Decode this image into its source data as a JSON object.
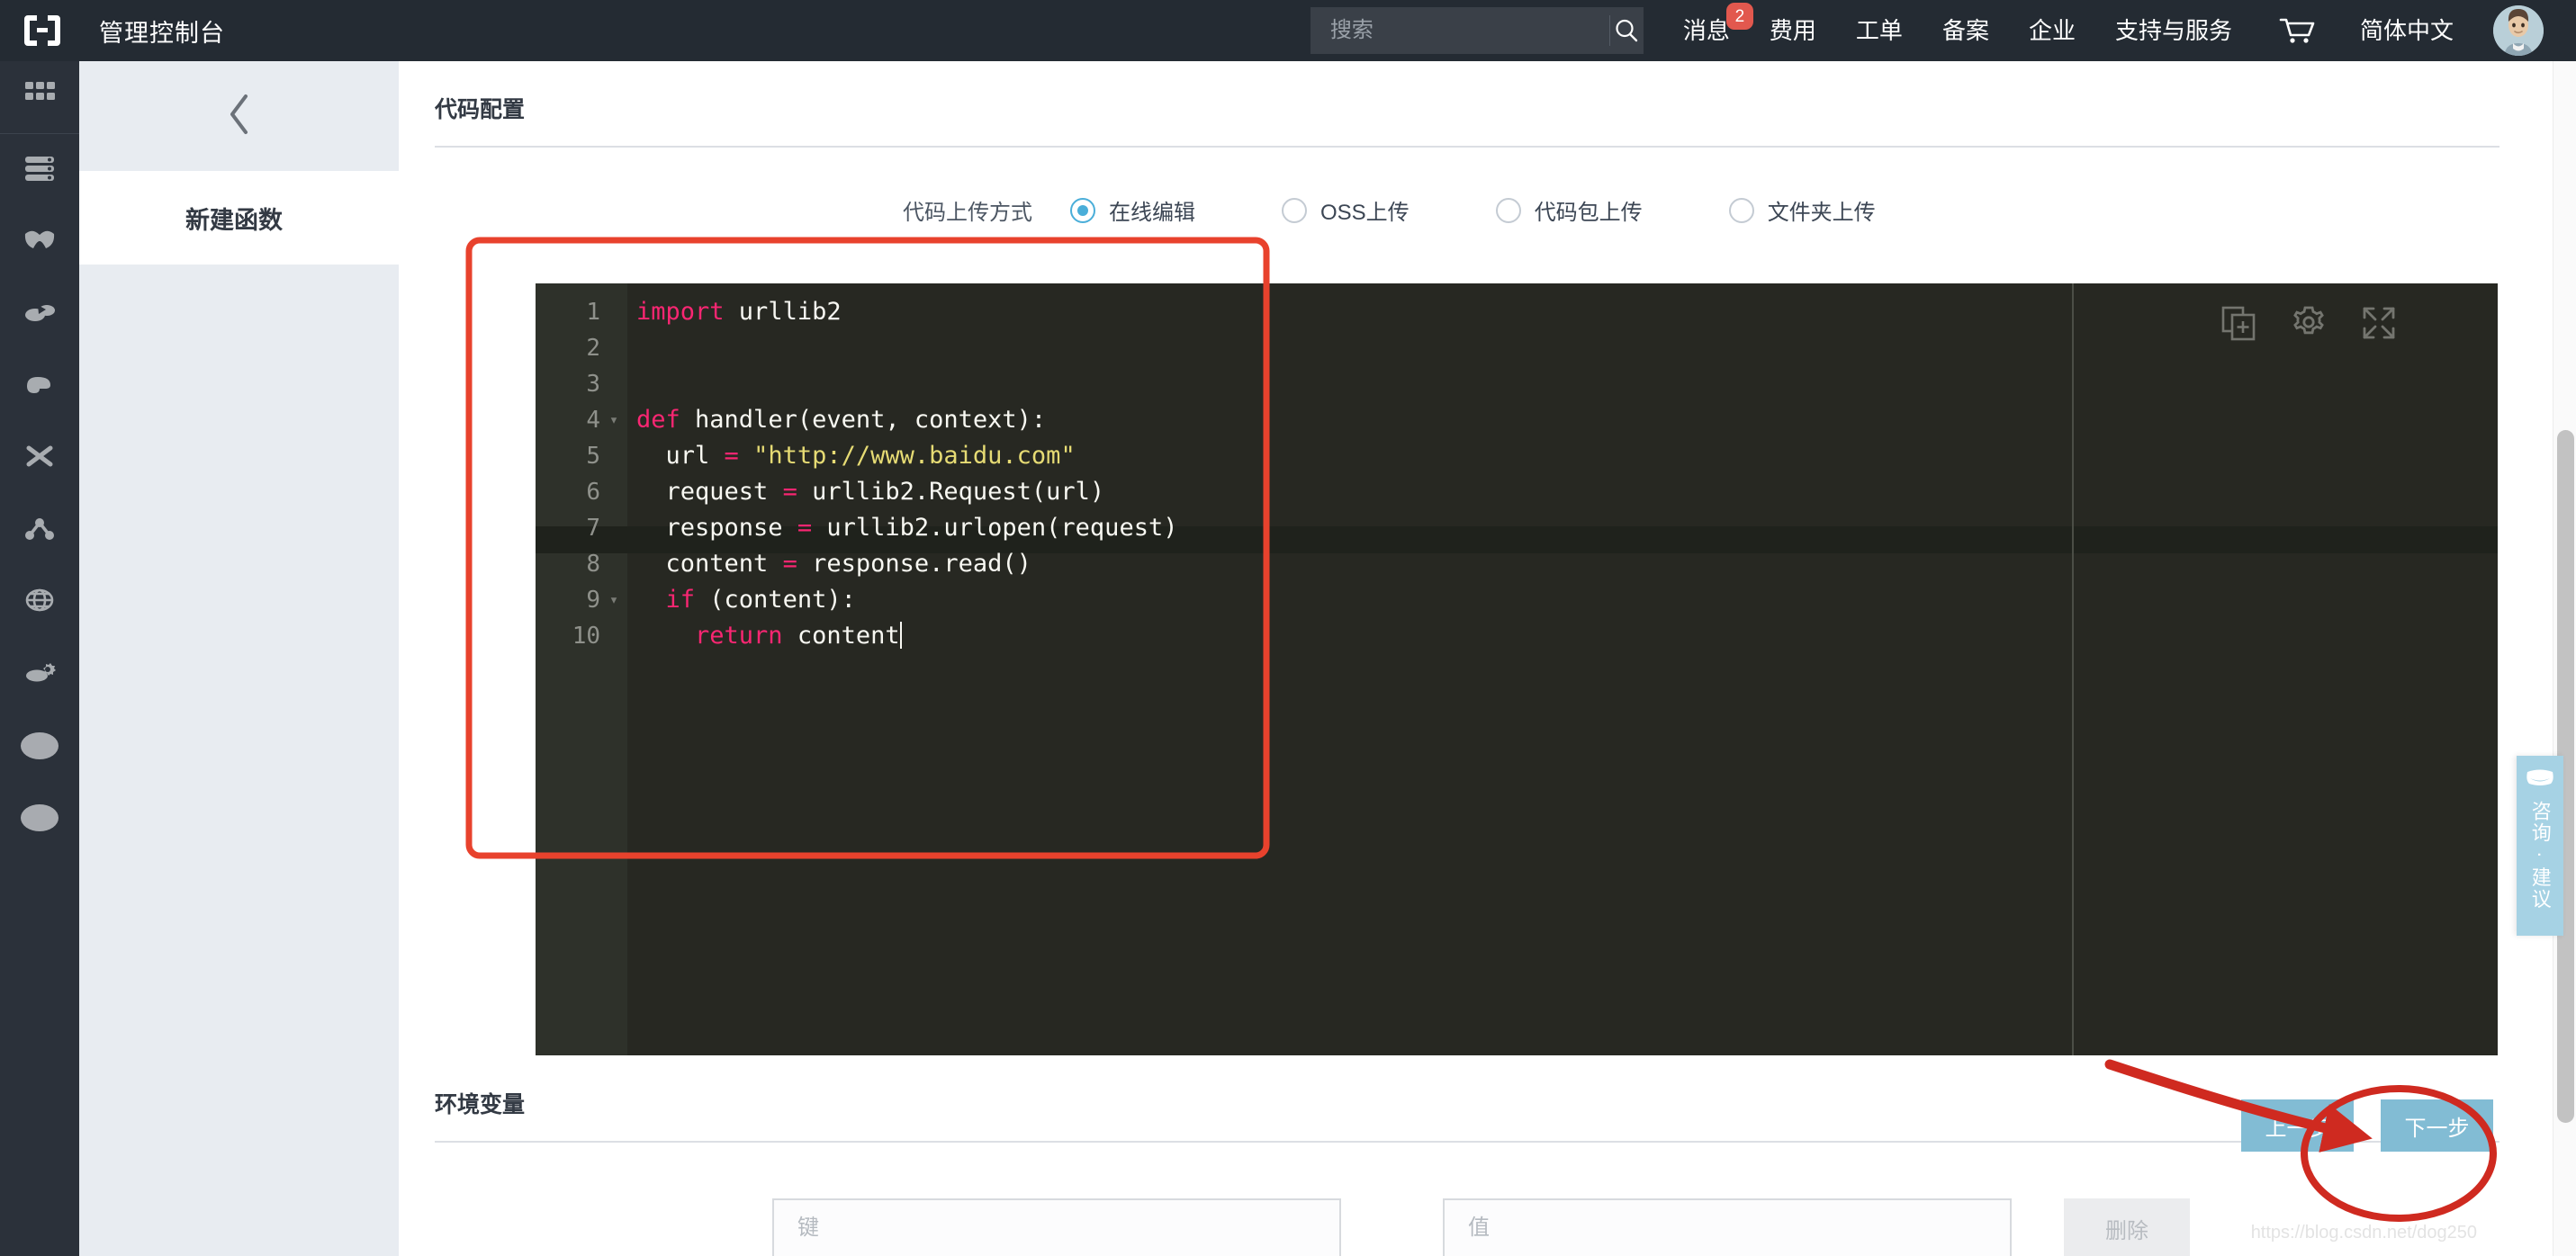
{
  "topbar": {
    "logo_icon": "brackets-logo-icon",
    "title": "管理控制台",
    "search": {
      "placeholder": "搜索",
      "value": "",
      "icon": "search-icon"
    },
    "nav": [
      {
        "label": "消息",
        "badge": "2"
      },
      {
        "label": "费用",
        "badge": ""
      },
      {
        "label": "工单",
        "badge": ""
      },
      {
        "label": "备案",
        "badge": ""
      },
      {
        "label": "企业",
        "badge": ""
      },
      {
        "label": "支持与服务",
        "badge": ""
      }
    ],
    "cart_icon": "shopping-cart-icon",
    "language": "简体中文",
    "avatar_icon": "user-avatar-icon"
  },
  "rail": {
    "items": [
      {
        "icon": "grid-apps-icon"
      },
      {
        "icon": "server-stack-icon"
      },
      {
        "icon": "shield-security-icon"
      },
      {
        "icon": "cloud-storage-icon"
      },
      {
        "icon": "database-icon"
      },
      {
        "icon": "network-cross-icon"
      },
      {
        "icon": "nodes-graph-icon"
      },
      {
        "icon": "globe-network-icon"
      },
      {
        "icon": "cloud-gear-icon"
      },
      {
        "icon": "ellipse-icon"
      },
      {
        "icon": "ellipse-icon"
      }
    ]
  },
  "sidepanel": {
    "collapse_icon": "chevron-left-icon",
    "title": "新建函数"
  },
  "main": {
    "code_config": {
      "heading": "代码配置",
      "upload_label": "代码上传方式",
      "options": [
        {
          "label": "在线编辑",
          "checked": true
        },
        {
          "label": "OSS上传",
          "checked": false
        },
        {
          "label": "代码包上传",
          "checked": false
        },
        {
          "label": "文件夹上传",
          "checked": false
        }
      ]
    },
    "editor": {
      "tools": [
        {
          "icon": "new-file-icon"
        },
        {
          "icon": "gear-icon"
        },
        {
          "icon": "fullscreen-expand-icon"
        }
      ],
      "active_line": 10,
      "lines": [
        {
          "n": "1",
          "fold": "",
          "html": "<span class=\"kw\">import</span> urllib2"
        },
        {
          "n": "2",
          "fold": "",
          "html": ""
        },
        {
          "n": "3",
          "fold": "",
          "html": ""
        },
        {
          "n": "4",
          "fold": "▾",
          "html": "<span class=\"kw\">def</span> handler(event, context):"
        },
        {
          "n": "5",
          "fold": "",
          "html": "  url <span class=\"op\">=</span> <span class=\"str\">\"http://www.baidu.com\"</span>"
        },
        {
          "n": "6",
          "fold": "",
          "html": "  request <span class=\"op\">=</span> urllib2.Request(url)"
        },
        {
          "n": "7",
          "fold": "",
          "html": "  response <span class=\"op\">=</span> urllib2.urlopen(request)"
        },
        {
          "n": "8",
          "fold": "",
          "html": "  content <span class=\"op\">=</span> response.read()"
        },
        {
          "n": "9",
          "fold": "▾",
          "html": "  <span class=\"kw\">if</span> (content):"
        },
        {
          "n": "10",
          "fold": "",
          "html": "    <span class=\"kw\">return</span> content<span class=\"caret\"></span>"
        }
      ],
      "plain_code": "import urllib2\n\n\ndef handler(event, context):\n  url = \"http://www.baidu.com\"\n  request = urllib2.Request(url)\n  response = urllib2.urlopen(request)\n  content = response.read()\n  if (content):\n    return content"
    },
    "env": {
      "heading": "环境变量",
      "key_placeholder": "键",
      "key_value": "",
      "value_placeholder": "值",
      "value_value": "",
      "delete_label": "删除"
    },
    "footer": {
      "prev_label": "上一步",
      "next_label": "下一步"
    }
  },
  "widgets": {
    "consult_icon": "chat-bubble-icon",
    "consult_label": "咨询 · 建议"
  },
  "watermark": "https://blog.csdn.net/dog250",
  "colors": {
    "topbar_bg": "#242b33",
    "rail_bg": "#2b313a",
    "sidepanel_bg": "#e8ecf1",
    "accent_blue": "#82bcd4",
    "radio_blue": "#4aaed9",
    "badge_red": "#e2584e",
    "annotation_red": "#e8422d",
    "editor_bg": "#272822",
    "keyword": "#f92672",
    "string": "#e6db74"
  }
}
